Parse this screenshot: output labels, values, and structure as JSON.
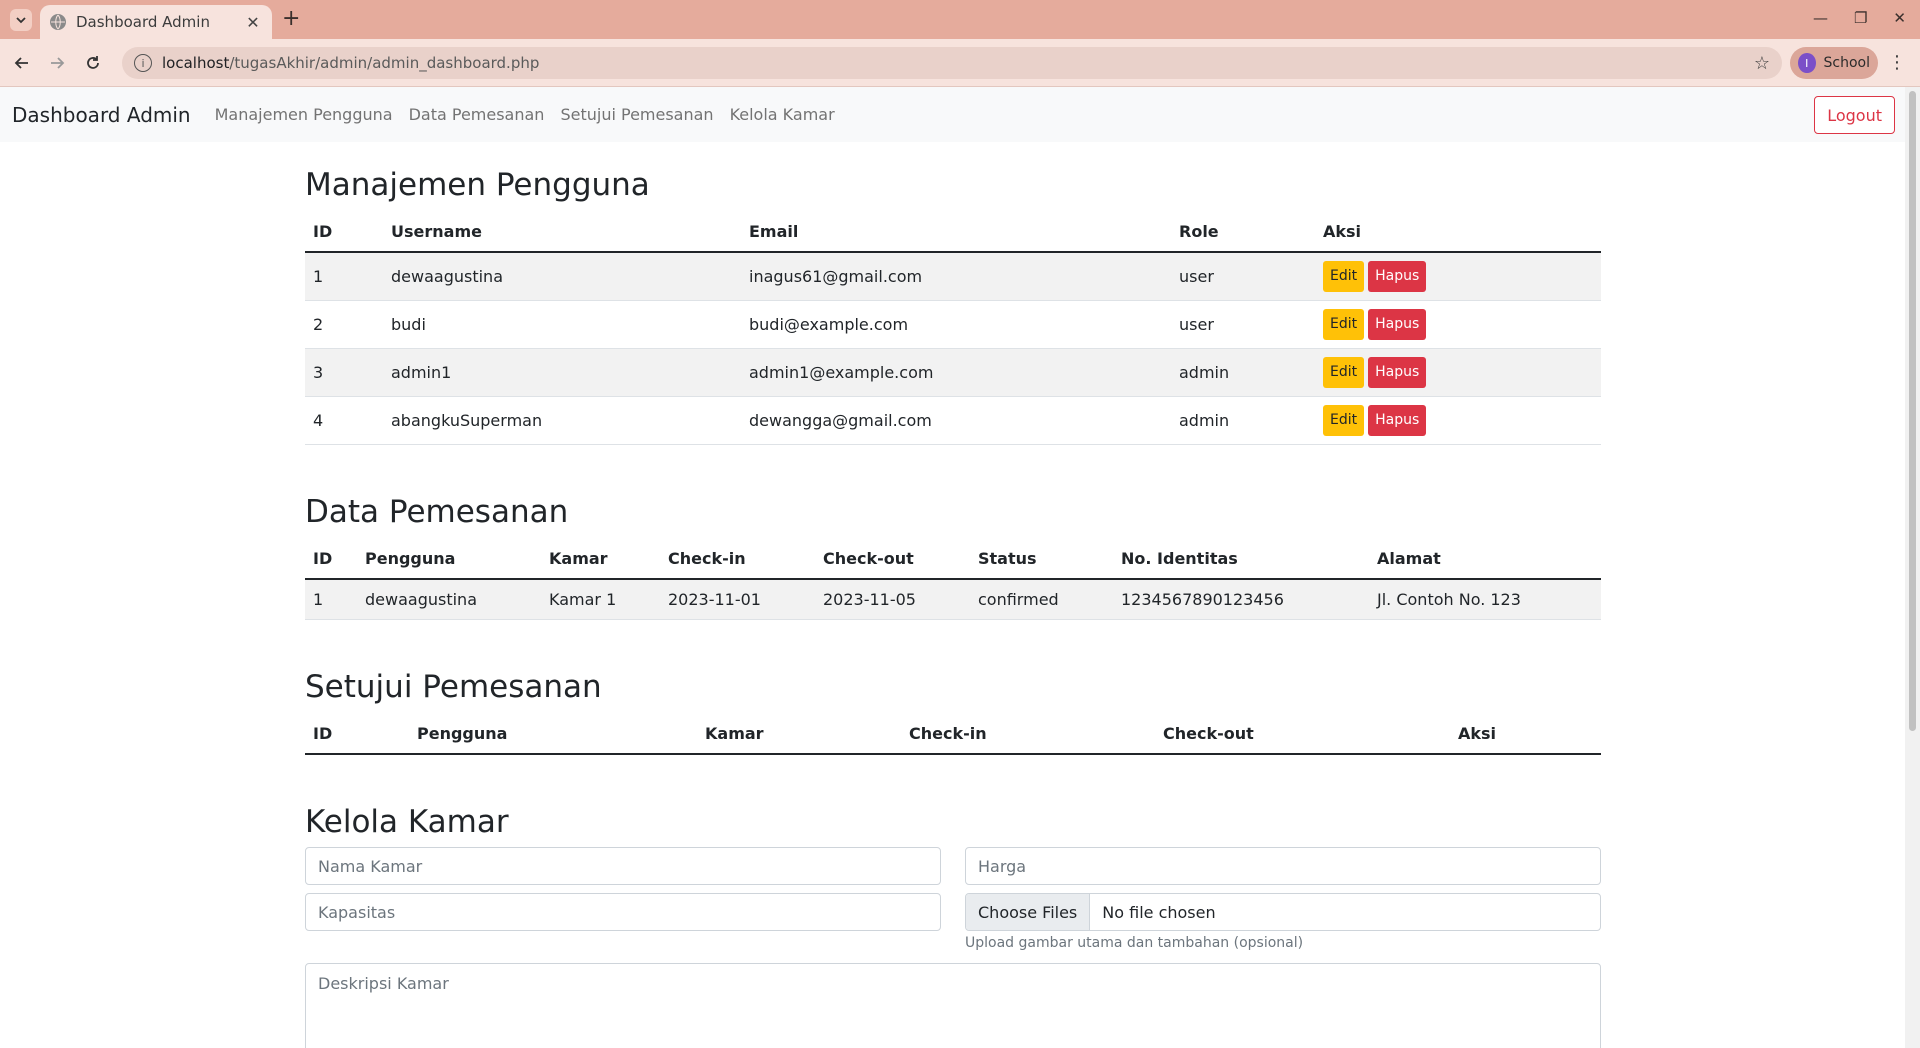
{
  "browser": {
    "tab_title": "Dashboard Admin",
    "url_host": "localhost",
    "url_path": "/tugasAkhir/admin/admin_dashboard.php",
    "profile_initial": "I",
    "profile_label": "School"
  },
  "navbar": {
    "brand": "Dashboard Admin",
    "links": [
      "Manajemen Pengguna",
      "Data Pemesanan",
      "Setujui Pemesanan",
      "Kelola Kamar"
    ],
    "logout": "Logout"
  },
  "users": {
    "title": "Manajemen Pengguna",
    "headers": [
      "ID",
      "Username",
      "Email",
      "Role",
      "Aksi"
    ],
    "edit_label": "Edit",
    "delete_label": "Hapus",
    "rows": [
      {
        "id": "1",
        "username": "dewaagustina",
        "email": "inagus61@gmail.com",
        "role": "user"
      },
      {
        "id": "2",
        "username": "budi",
        "email": "budi@example.com",
        "role": "user"
      },
      {
        "id": "3",
        "username": "admin1",
        "email": "admin1@example.com",
        "role": "admin"
      },
      {
        "id": "4",
        "username": "abangkuSuperman",
        "email": "dewangga@gmail.com",
        "role": "admin"
      }
    ]
  },
  "bookings": {
    "title": "Data Pemesanan",
    "headers": [
      "ID",
      "Pengguna",
      "Kamar",
      "Check-in",
      "Check-out",
      "Status",
      "No. Identitas",
      "Alamat"
    ],
    "rows": [
      {
        "id": "1",
        "user": "dewaagustina",
        "room": "Kamar 1",
        "checkin": "2023-11-01",
        "checkout": "2023-11-05",
        "status": "confirmed",
        "identity": "1234567890123456",
        "address": "Jl. Contoh No. 123"
      }
    ]
  },
  "approve": {
    "title": "Setujui Pemesanan",
    "headers": [
      "ID",
      "Pengguna",
      "Kamar",
      "Check-in",
      "Check-out",
      "Aksi"
    ]
  },
  "rooms": {
    "title": "Kelola Kamar",
    "name_placeholder": "Nama Kamar",
    "price_placeholder": "Harga",
    "capacity_placeholder": "Kapasitas",
    "file_button": "Choose Files",
    "file_status": "No file chosen",
    "file_help": "Upload gambar utama dan tambahan (opsional)",
    "description_placeholder": "Deskripsi Kamar"
  }
}
